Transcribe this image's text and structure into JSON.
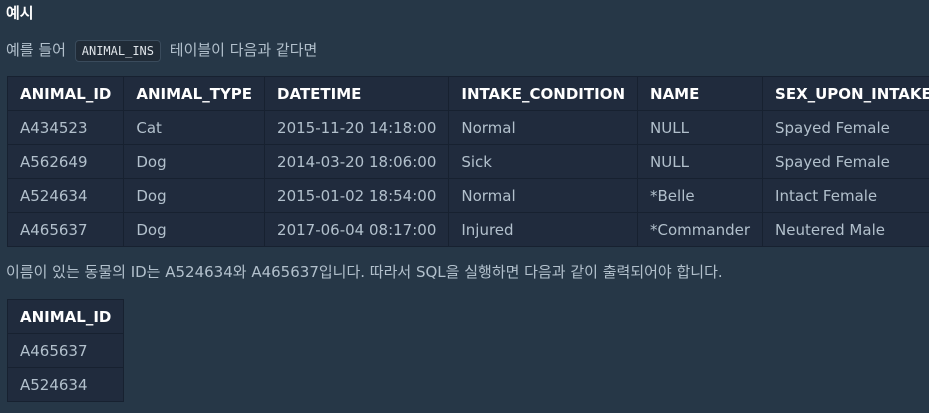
{
  "heading": "예시",
  "intro": {
    "before": "예를 들어",
    "code": "ANIMAL_INS",
    "after": "테이블이 다음과 같다면"
  },
  "main_table": {
    "columns": [
      "ANIMAL_ID",
      "ANIMAL_TYPE",
      "DATETIME",
      "INTAKE_CONDITION",
      "NAME",
      "SEX_UPON_INTAKE"
    ],
    "rows": [
      [
        "A434523",
        "Cat",
        "2015-11-20 14:18:00",
        "Normal",
        "NULL",
        "Spayed Female"
      ],
      [
        "A562649",
        "Dog",
        "2014-03-20 18:06:00",
        "Sick",
        "NULL",
        "Spayed Female"
      ],
      [
        "A524634",
        "Dog",
        "2015-01-02 18:54:00",
        "Normal",
        "*Belle",
        "Intact Female"
      ],
      [
        "A465637",
        "Dog",
        "2017-06-04 08:17:00",
        "Injured",
        "*Commander",
        "Neutered Male"
      ]
    ]
  },
  "summary": "이름이 있는 동물의 ID는 A524634와 A465637입니다. 따라서 SQL을 실행하면 다음과 같이 출력되어야 합니다.",
  "result_table": {
    "columns": [
      "ANIMAL_ID"
    ],
    "rows": [
      [
        "A465637"
      ],
      [
        "A524634"
      ]
    ]
  }
}
